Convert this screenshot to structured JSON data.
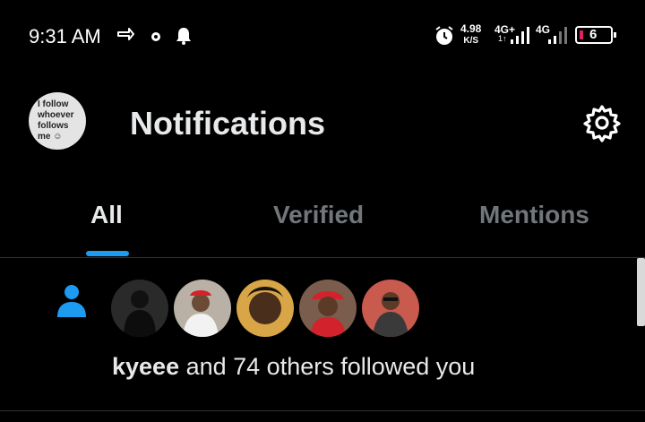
{
  "status_bar": {
    "time": "9:31 AM",
    "net_speed_value": "4.98",
    "net_speed_unit": "K/S",
    "network_1": "4G+",
    "network_1_sub": "1↑",
    "network_2": "4G",
    "battery": "6",
    "colors": {
      "battery_low": "#e0245e"
    }
  },
  "header": {
    "avatar_text": "I follow\nwhoever\nfollows\nme ☺",
    "title": "Notifications"
  },
  "tabs": [
    {
      "label": "All",
      "active": true
    },
    {
      "label": "Verified",
      "active": false
    },
    {
      "label": "Mentions",
      "active": false
    }
  ],
  "notification": {
    "icon": "person-icon",
    "avatars": [
      "avatar-1",
      "avatar-2",
      "avatar-3",
      "avatar-4",
      "avatar-5"
    ],
    "user": "kyeee",
    "rest": " and 74 others followed you"
  },
  "colors": {
    "accent": "#1d9bf0",
    "background": "#000000",
    "text": "#e7e9ea",
    "muted": "#71767b"
  }
}
